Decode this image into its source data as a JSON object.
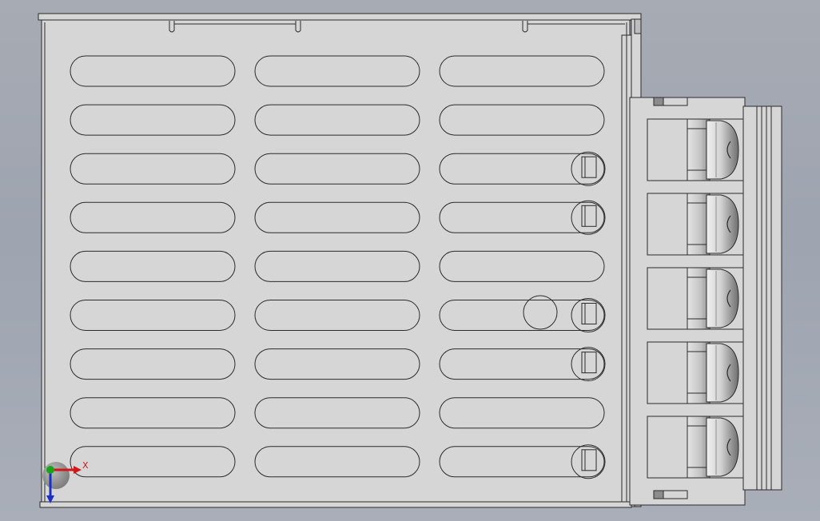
{
  "viewport": {
    "background_top": "#a7abb3",
    "background_bottom": "#a9aeb8"
  },
  "part": {
    "face_color": "#d6d6d6",
    "edge_color": "#2b2b2b",
    "shade_color": "#bdbdbd",
    "dark_shade_color": "#8c8c8c"
  },
  "vent_slots": {
    "columns": 3,
    "rows": 9
  },
  "cable_glands": {
    "count": 5
  },
  "triad": {
    "x_label": "X",
    "x_color": "#d01818",
    "y_color": "#17a417",
    "z_color": "#1a2fc8"
  }
}
